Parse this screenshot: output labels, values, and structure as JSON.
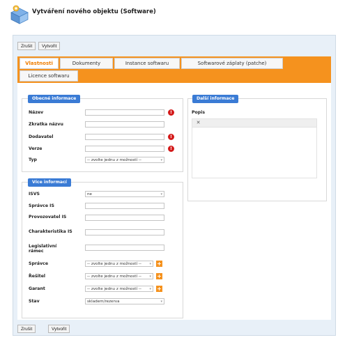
{
  "page": {
    "title": "Vytváření nového objektu (Software)"
  },
  "toolbar": {
    "reset_label": "Zrušit",
    "create_label": "Vytvořit"
  },
  "tabs": [
    {
      "label": "Vlastnosti",
      "active": true
    },
    {
      "label": "Dokumenty",
      "active": false
    },
    {
      "label": "Instance softwaru",
      "active": false
    },
    {
      "label": "Softwarové záplaty (patche)",
      "active": false
    },
    {
      "label": "Licence softwaru",
      "active": false
    }
  ],
  "general": {
    "legend": "Obecné informace",
    "fields": {
      "name": {
        "label": "Název",
        "value": ""
      },
      "abbr": {
        "label": "Zkratka názvu",
        "value": ""
      },
      "vendor": {
        "label": "Dodavatel",
        "value": ""
      },
      "version": {
        "label": "Verze",
        "value": ""
      },
      "type": {
        "label": "Typ",
        "value": "-- zvolte jednu z možností --"
      }
    }
  },
  "additional": {
    "legend": "Další informace",
    "popis_label": "Popis"
  },
  "more": {
    "legend": "Více informací",
    "fields": {
      "isvs": {
        "label": "ISVS",
        "value": "ne"
      },
      "spravce_is": {
        "label": "Správce IS",
        "value": ""
      },
      "provozovatel_is": {
        "label": "Provozovatel IS",
        "value": ""
      },
      "charakteristika_is": {
        "label": "Charakteristika IS",
        "value": ""
      },
      "legislativni_ramec": {
        "label": "Legislativní rámec",
        "value": ""
      },
      "spravce": {
        "label": "Správce",
        "value": "-- zvolte jednu z možností --"
      },
      "resitel": {
        "label": "Řešitel",
        "value": "-- zvolte jednu z možností --"
      },
      "garant": {
        "label": "Garant",
        "value": "-- zvolte jednu z možností --"
      },
      "stav": {
        "label": "Stav",
        "value": "skladem/rezerva"
      }
    }
  },
  "colors": {
    "accent": "#f5921e",
    "legend": "#3a7bd5",
    "required": "#d31a1a",
    "panel": "#e8f0f8"
  },
  "icons": {
    "logo": "software-package-icon",
    "required": "required-icon",
    "add": "plus-icon",
    "editor": "editor-tool-icon"
  }
}
